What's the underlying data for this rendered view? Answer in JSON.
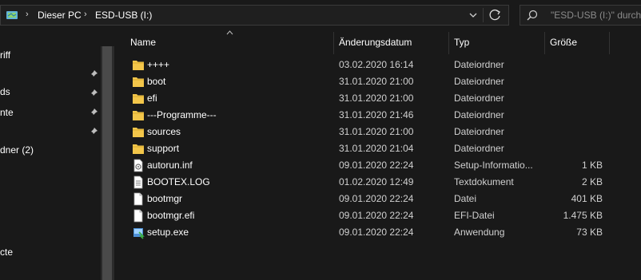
{
  "address": {
    "crumbs": [
      "Dieser PC",
      "ESD-USB (I:)"
    ]
  },
  "search": {
    "placeholder": "\"ESD-USB (I:)\" durchs"
  },
  "nav": {
    "items": [
      {
        "label": "riff",
        "pinned": false
      },
      {
        "label": "ds",
        "pinned": true
      },
      {
        "label": "nte",
        "pinned": true
      },
      {
        "label": "",
        "pinned": true
      },
      {
        "label": "dner (2)",
        "pinned": false
      },
      {
        "label": "cte",
        "pinned": false
      }
    ]
  },
  "columns": {
    "name": "Name",
    "date": "Änderungsdatum",
    "type": "Typ",
    "size": "Größe"
  },
  "files": [
    {
      "name": "++++",
      "date": "03.02.2020 16:14",
      "type": "Dateiordner",
      "size": "",
      "icon": "folder"
    },
    {
      "name": "boot",
      "date": "31.01.2020 21:00",
      "type": "Dateiordner",
      "size": "",
      "icon": "folder"
    },
    {
      "name": "efi",
      "date": "31.01.2020 21:00",
      "type": "Dateiordner",
      "size": "",
      "icon": "folder"
    },
    {
      "name": "---Programme---",
      "date": "31.01.2020 21:46",
      "type": "Dateiordner",
      "size": "",
      "icon": "folder"
    },
    {
      "name": "sources",
      "date": "31.01.2020 21:00",
      "type": "Dateiordner",
      "size": "",
      "icon": "folder"
    },
    {
      "name": "support",
      "date": "31.01.2020 21:04",
      "type": "Dateiordner",
      "size": "",
      "icon": "folder"
    },
    {
      "name": "autorun.inf",
      "date": "09.01.2020 22:24",
      "type": "Setup-Informatio...",
      "size": "1 KB",
      "icon": "setup-info"
    },
    {
      "name": "BOOTEX.LOG",
      "date": "01.02.2020 12:49",
      "type": "Textdokument",
      "size": "2 KB",
      "icon": "text-doc"
    },
    {
      "name": "bootmgr",
      "date": "09.01.2020 22:24",
      "type": "Datei",
      "size": "401 KB",
      "icon": "file"
    },
    {
      "name": "bootmgr.efi",
      "date": "09.01.2020 22:24",
      "type": "EFI-Datei",
      "size": "1.475 KB",
      "icon": "file"
    },
    {
      "name": "setup.exe",
      "date": "09.01.2020 22:24",
      "type": "Anwendung",
      "size": "73 KB",
      "icon": "setup-exe"
    }
  ],
  "colors": {
    "background": "#191919",
    "folder": "#f3c64a",
    "text": "#ffffff"
  }
}
